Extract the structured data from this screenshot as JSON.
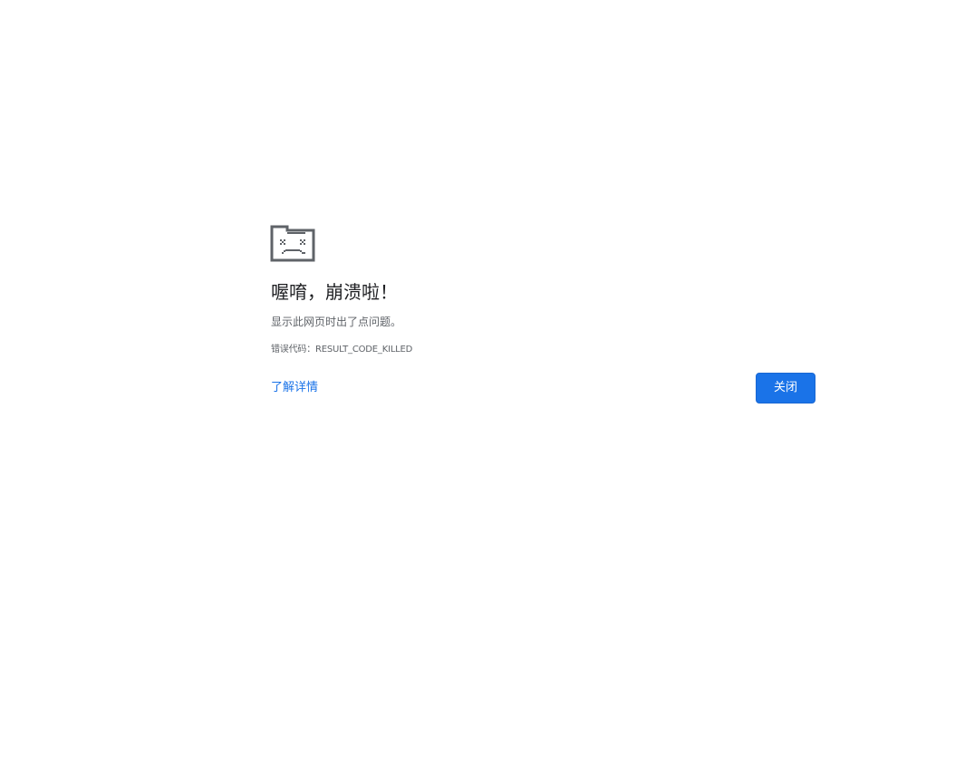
{
  "error_page": {
    "icon": "sad-tab-icon",
    "title": "喔唷，崩溃啦！",
    "message": "显示此网页时出了点问题。",
    "error_code": "错误代码：RESULT_CODE_KILLED",
    "learn_more_label": "了解详情",
    "close_label": "关闭"
  },
  "colors": {
    "background": "#ffffff",
    "title": "#202124",
    "secondary_text": "#5f6368",
    "link": "#1a73e8",
    "button": "#1a73e8",
    "icon": "#5f6368"
  }
}
